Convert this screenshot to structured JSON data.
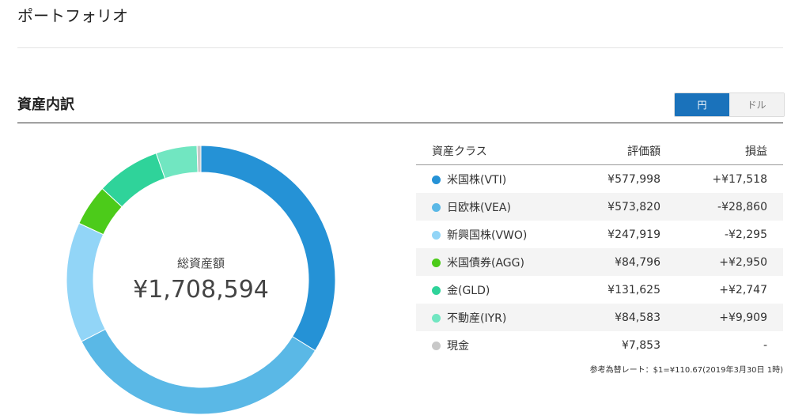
{
  "page": {
    "title": "ポートフォリオ"
  },
  "section": {
    "title": "資産内訳"
  },
  "currency_toggle": {
    "options": [
      "円",
      "ドル"
    ],
    "selected": "円"
  },
  "summary": {
    "label": "総資産額",
    "value": "¥1,708,594"
  },
  "table": {
    "headers": [
      "資産クラス",
      "評価額",
      "損益"
    ],
    "rows": [
      {
        "name": "米国株(VTI)",
        "value": "¥577,998",
        "amount": 577998,
        "pl": "+¥17,518",
        "pl_sign": "pos",
        "color": "#2592d6"
      },
      {
        "name": "日欧株(VEA)",
        "value": "¥573,820",
        "amount": 573820,
        "pl": "-¥28,860",
        "pl_sign": "neg",
        "color": "#5ab8e6"
      },
      {
        "name": "新興国株(VWO)",
        "value": "¥247,919",
        "amount": 247919,
        "pl": "-¥2,295",
        "pl_sign": "neg",
        "color": "#92d5f7"
      },
      {
        "name": "米国債券(AGG)",
        "value": "¥84,796",
        "amount": 84796,
        "pl": "+¥2,950",
        "pl_sign": "pos",
        "color": "#4ccb1a"
      },
      {
        "name": "金(GLD)",
        "value": "¥131,625",
        "amount": 131625,
        "pl": "+¥2,747",
        "pl_sign": "pos",
        "color": "#2fd39a"
      },
      {
        "name": "不動産(IYR)",
        "value": "¥84,583",
        "amount": 84583,
        "pl": "+¥9,909",
        "pl_sign": "pos",
        "color": "#71e6c1"
      },
      {
        "name": "現金",
        "value": "¥7,853",
        "amount": 7853,
        "pl": "-",
        "pl_sign": "neu",
        "color": "#c8c8c8"
      }
    ]
  },
  "footnote": "参考為替レート：$1=¥110.67(2019年3月30日 1時)"
}
